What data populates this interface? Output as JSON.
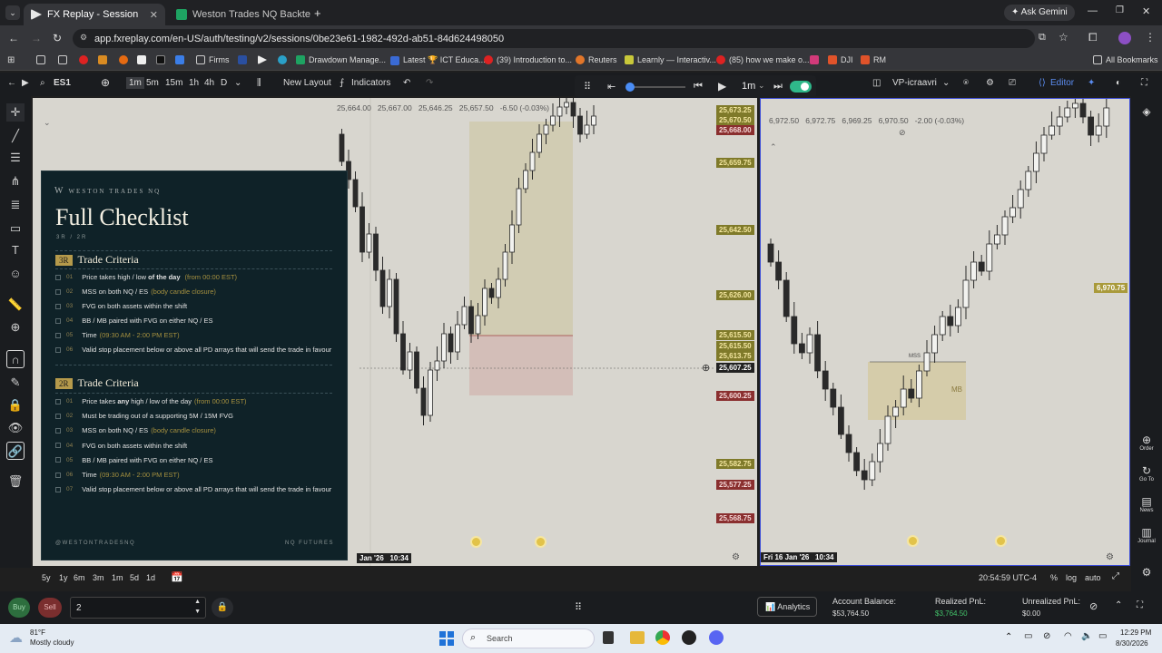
{
  "browser": {
    "tabs": [
      {
        "label": "FX Replay - Session",
        "active": true
      },
      {
        "label": "Weston Trades NQ Backtesting",
        "active": false
      }
    ],
    "ask_gemini": "Ask Gemini",
    "url": "app.fxreplay.com/en-US/auth/testing/v2/sessions/0be23e61-1982-492d-ab51-84d624498050",
    "bookmarks": [
      "Firms",
      "Drawdown Manage...",
      "Latest 🏆 ICT Educa...",
      "(39) Introduction to...",
      "Reuters",
      "Learnly — Interactiv...",
      "(85) how we make o...",
      "DJI",
      "RM"
    ],
    "all_bookmarks": "All Bookmarks"
  },
  "toolbar": {
    "symbol": "ES1",
    "timeframes": [
      "1m",
      "5m",
      "15m",
      "1h",
      "4h",
      "D"
    ],
    "new_layout": "New Layout",
    "indicators": "Indicators",
    "replay_tf": "1m",
    "layout_name": "VP-icraavri",
    "editor": "Editor"
  },
  "chart1": {
    "ohlc": [
      "25,664.00",
      "25,667.00",
      "25,646.25",
      "25,657.50",
      "-6.50 (-0.03%)"
    ],
    "price_tags": [
      {
        "text": "25,673.25",
        "style": "green"
      },
      {
        "text": "25,670.50",
        "style": "green"
      },
      {
        "text": "25,668.00",
        "style": "red"
      },
      {
        "text": "25,659.75",
        "style": "green"
      },
      {
        "text": "25,642.50",
        "style": "green"
      },
      {
        "text": "25,626.00",
        "style": "green"
      },
      {
        "text": "25,615.50",
        "style": "green"
      },
      {
        "text": "25,615.50",
        "style": "green"
      },
      {
        "text": "25,613.75",
        "style": "green"
      },
      {
        "text": "25,607.25",
        "style": "dark"
      },
      {
        "text": "25,600.25",
        "style": "red"
      },
      {
        "text": "25,582.75",
        "style": "green"
      },
      {
        "text": "25,577.25",
        "style": "red"
      },
      {
        "text": "25,568.75",
        "style": "red"
      }
    ],
    "time_left": "Jan '26",
    "time_cursor": "10:34"
  },
  "chart2": {
    "ohlc": [
      "6,972.50",
      "6,972.75",
      "6,969.25",
      "6,970.50",
      "-2.00 (-0.03%)"
    ],
    "price_tag": "6,970.75",
    "mss_label": "MSS",
    "mb_label": "MB",
    "time_cursor": "Fri 16 Jan '26   10:34"
  },
  "checklist": {
    "brand": "WESTON TRADES NQ",
    "title": "Full Checklist",
    "subtitle": "3R / 2R",
    "section1": {
      "badge": "3R",
      "title": "Trade Criteria",
      "items": [
        {
          "num": "01",
          "pre": "Price takes high / low",
          "bold": "of the day",
          "post": "",
          "hl": "(from 00:00 EST)"
        },
        {
          "num": "02",
          "pre": "MSS on both NQ / ES",
          "bold": "",
          "post": "",
          "hl": "(body candle closure)"
        },
        {
          "num": "03",
          "pre": "FVG on both assets within the shift",
          "bold": "",
          "post": "",
          "hl": ""
        },
        {
          "num": "04",
          "pre": "BB / MB paired with FVG on either NQ / ES",
          "bold": "",
          "post": "",
          "hl": ""
        },
        {
          "num": "05",
          "pre": "Time",
          "bold": "",
          "post": "",
          "hl": "(09:30 AM - 2:00 PM EST)"
        },
        {
          "num": "06",
          "pre": "Valid stop placement below or above all PD arrays that will send the trade in favour",
          "bold": "",
          "post": "",
          "hl": ""
        }
      ]
    },
    "section2": {
      "badge": "2R",
      "title": "Trade Criteria",
      "items": [
        {
          "num": "01",
          "pre": "Price takes",
          "bold": "any",
          "post": "high / low of the day",
          "hl": "(from 00:00 EST)"
        },
        {
          "num": "02",
          "pre": "Must be trading out of a supporting 5M / 15M FVG",
          "bold": "",
          "post": "",
          "hl": ""
        },
        {
          "num": "03",
          "pre": "MSS on both NQ / ES",
          "bold": "",
          "post": "",
          "hl": "(body candle closure)"
        },
        {
          "num": "04",
          "pre": "FVG on both assets within the shift",
          "bold": "",
          "post": "",
          "hl": ""
        },
        {
          "num": "05",
          "pre": "BB / MB paired with FVG on either NQ / ES",
          "bold": "",
          "post": "",
          "hl": ""
        },
        {
          "num": "06",
          "pre": "Time",
          "bold": "",
          "post": "",
          "hl": "(09:30 AM - 2:00 PM EST)"
        },
        {
          "num": "07",
          "pre": "Valid stop placement below or above all PD arrays that will send the trade in favour",
          "bold": "",
          "post": "",
          "hl": ""
        }
      ]
    },
    "footer_left": "@WESTONTRADESNQ",
    "footer_right": "NQ FUTURES"
  },
  "bottom_nav": {
    "ranges": [
      "5y",
      "1y",
      "6m",
      "3m",
      "1m",
      "5d",
      "1d"
    ],
    "clock": "20:54:59 UTC-4",
    "pct": "%",
    "log": "log",
    "auto": "auto"
  },
  "trade": {
    "buy": "Buy",
    "sell": "Sell",
    "qty": "2",
    "analytics": "Analytics",
    "account_balance_label": "Account Balance:",
    "account_balance": "$53,764.50",
    "realized_label": "Realized PnL:",
    "realized": "$3,764.50",
    "unrealized_label": "Unrealized PnL:",
    "unrealized": "$0.00"
  },
  "right_sidebar": [
    "Order",
    "Go To",
    "News",
    "Journal"
  ],
  "taskbar": {
    "weather_temp": "81°F",
    "weather_desc": "Mostly cloudy",
    "search": "Search",
    "time": "12:29 PM",
    "date": "8/30/2026"
  }
}
